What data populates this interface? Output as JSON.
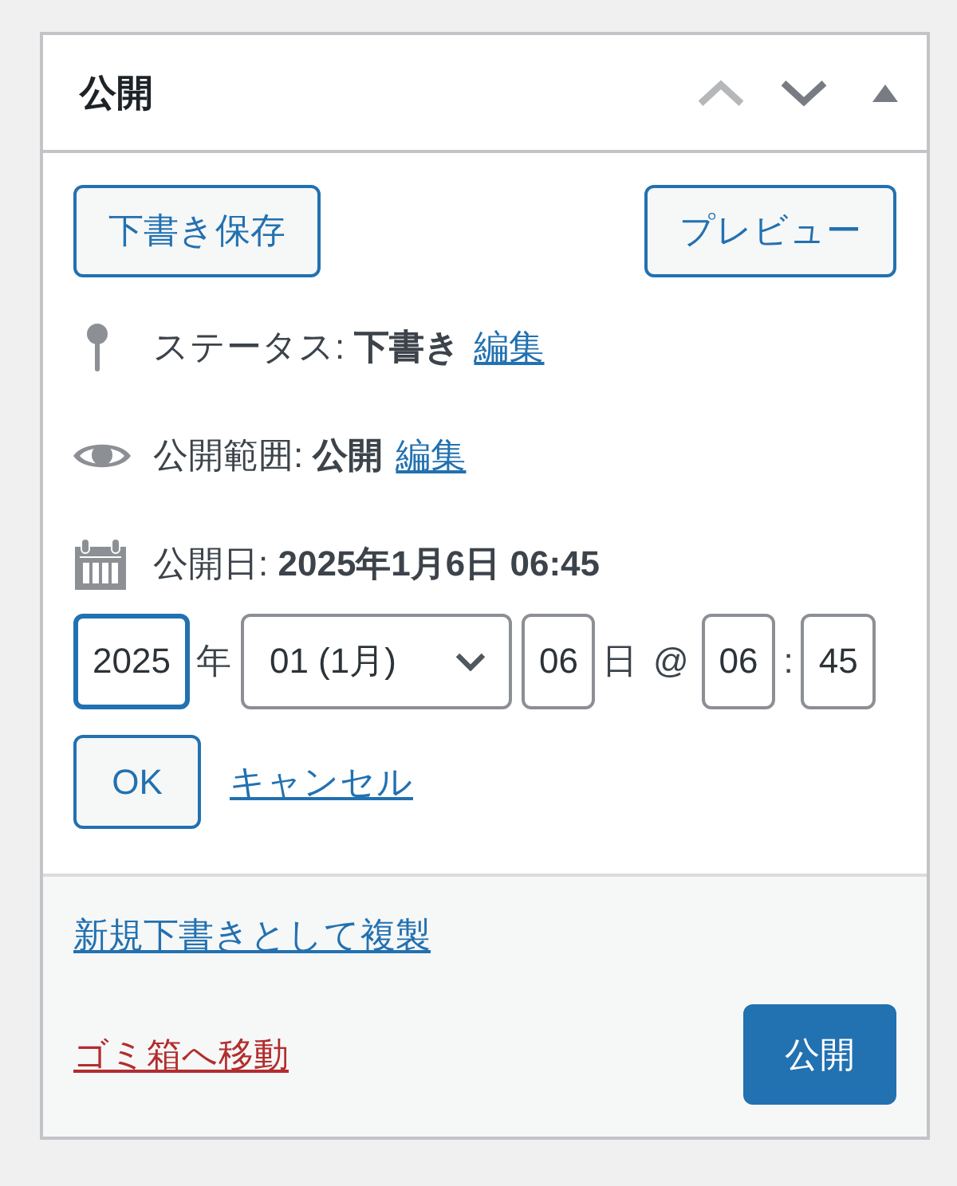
{
  "panel": {
    "title": "公開",
    "expanded": true,
    "header_buttons": [
      {
        "kind": "up",
        "disabled": true
      },
      {
        "kind": "down",
        "disabled": false
      }
    ]
  },
  "actions": {
    "save_draft": "下書き保存",
    "preview": "プレビュー"
  },
  "misc": [
    {
      "kind": "status",
      "text": "ステータス: **下書き**",
      "link": "編集"
    },
    {
      "kind": "visibility",
      "text": "公開範囲: **公開**",
      "link": "編集"
    },
    {
      "kind": "schedule",
      "text": "公開日: **2025年1月6日 06:45**"
    }
  ],
  "date_editor": {
    "fields": [
      {
        "kind": "year",
        "value": "2025",
        "focused": true
      },
      {
        "kind": "unit",
        "text": "年"
      },
      {
        "kind": "month",
        "value": "01 (1月)",
        "focused": false
      },
      {
        "kind": "day",
        "value": "06",
        "focused": false
      },
      {
        "kind": "unit",
        "text": "日"
      },
      {
        "kind": "at",
        "text": "@"
      },
      {
        "kind": "hour",
        "value": "06",
        "focused": false
      },
      {
        "kind": "colon",
        "text": ":"
      },
      {
        "kind": "minute",
        "value": "45",
        "focused": false
      }
    ],
    "ok_button": "OK",
    "cancel_link": "キャンセル"
  },
  "footer": {
    "duplicate_link": "新規下書きとして複製",
    "trash_link": "ゴミ箱へ移動",
    "publish_button": "公開"
  }
}
